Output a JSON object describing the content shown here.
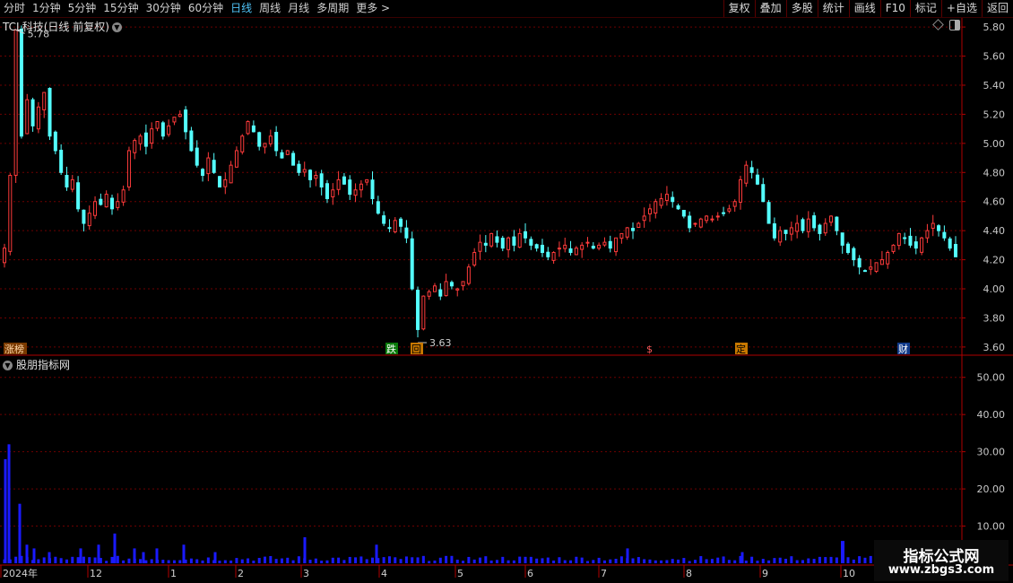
{
  "toolbar": {
    "periods": [
      "分时",
      "1分钟",
      "5分钟",
      "15分钟",
      "30分钟",
      "60分钟",
      "日线",
      "周线",
      "月线",
      "多周期",
      "更多 >"
    ],
    "active_period": "日线",
    "tools": [
      "复权",
      "叠加",
      "多股",
      "统计",
      "画线",
      "F10",
      "标记",
      "+自选",
      "返回"
    ]
  },
  "chart_title": "TCL科技(日线 前复权)",
  "indicator_title": "股朋指标网",
  "watermark": {
    "line1": "指标公式网",
    "line2": "www.zbgs3.com"
  },
  "colors": {
    "up": "#ff3b3b",
    "down": "#54ffff",
    "volume": "#1a1aff",
    "grid": "#6e0000",
    "axis": "#c8c8c8"
  },
  "chart_data": [
    {
      "type": "candlestick",
      "ylim": [
        3.55,
        5.85
      ],
      "yticks": [
        "5.80",
        "5.60",
        "5.40",
        "5.20",
        "5.00",
        "4.80",
        "4.60",
        "4.40",
        "4.20",
        "4.00",
        "3.80",
        "3.60"
      ],
      "annotations": [
        {
          "label": "5.78",
          "value": 5.78
        },
        {
          "label": "3.63",
          "value": 3.63
        }
      ],
      "event_markers": [
        "涨榜",
        "跌",
        "回",
        "$",
        "定",
        "财"
      ],
      "close_series": [
        4.28,
        4.78,
        5.78,
        5.05,
        5.3,
        5.12,
        5.25,
        5.35,
        5.05,
        4.95,
        4.8,
        4.7,
        4.75,
        4.55,
        4.45,
        4.52,
        4.6,
        4.58,
        4.65,
        4.55,
        4.6,
        4.68,
        4.95,
        5.02,
        5.05,
        4.98,
        5.1,
        5.15,
        5.05,
        5.12,
        5.18,
        5.2,
        5.08,
        4.95,
        4.85,
        4.78,
        4.9,
        4.8,
        4.7,
        4.75,
        4.85,
        4.95,
        5.05,
        5.15,
        5.08,
        4.98,
        5.0,
        5.05,
        4.95,
        4.9,
        4.95,
        4.85,
        4.8,
        4.82,
        4.75,
        4.78,
        4.7,
        4.62,
        4.68,
        4.75,
        4.72,
        4.65,
        4.68,
        4.72,
        4.75,
        4.62,
        4.52,
        4.45,
        4.42,
        4.47,
        4.43,
        4.35,
        4.0,
        3.72,
        3.95,
        3.98,
        4.02,
        3.95,
        4.05,
        4.02,
        4.0,
        4.05,
        4.15,
        4.25,
        4.32,
        4.3,
        4.38,
        4.32,
        4.28,
        4.35,
        4.3,
        4.38,
        4.35,
        4.3,
        4.28,
        4.25,
        4.22,
        4.25,
        4.28,
        4.3,
        4.25,
        4.28,
        4.3,
        4.32,
        4.28,
        4.3,
        4.32,
        4.28,
        4.35,
        4.38,
        4.42,
        4.4,
        4.45,
        4.5,
        4.55,
        4.6,
        4.62,
        4.65,
        4.6,
        4.55,
        4.5,
        4.42,
        4.45,
        4.48,
        4.5,
        4.48,
        4.5,
        4.52,
        4.55,
        4.6,
        4.75,
        4.85,
        4.8,
        4.72,
        4.6,
        4.45,
        4.35,
        4.4,
        4.38,
        4.42,
        4.45,
        4.4,
        4.48,
        4.42,
        4.38,
        4.45,
        4.5,
        4.4,
        4.3,
        4.25,
        4.2,
        4.15,
        4.12,
        4.15,
        4.18,
        4.2,
        4.25,
        4.3,
        4.38,
        4.35,
        4.3,
        4.28,
        4.35,
        4.4,
        4.45,
        4.4,
        4.35,
        4.28,
        4.22
      ]
    },
    {
      "type": "bar",
      "series_label": "volume",
      "ylim": [
        0,
        55
      ],
      "yticks": [
        "50.00",
        "40.00",
        "30.00",
        "20.00",
        "10.00"
      ],
      "x_labels": [
        "2024年",
        "12",
        "1",
        "2",
        "3",
        "4",
        "5",
        "6",
        "7",
        "8",
        "9",
        "10"
      ],
      "highlight_values": [
        28,
        32,
        16,
        5,
        4,
        3,
        4,
        5,
        8,
        4,
        3,
        4,
        5,
        3,
        7,
        5,
        4,
        3
      ]
    }
  ]
}
